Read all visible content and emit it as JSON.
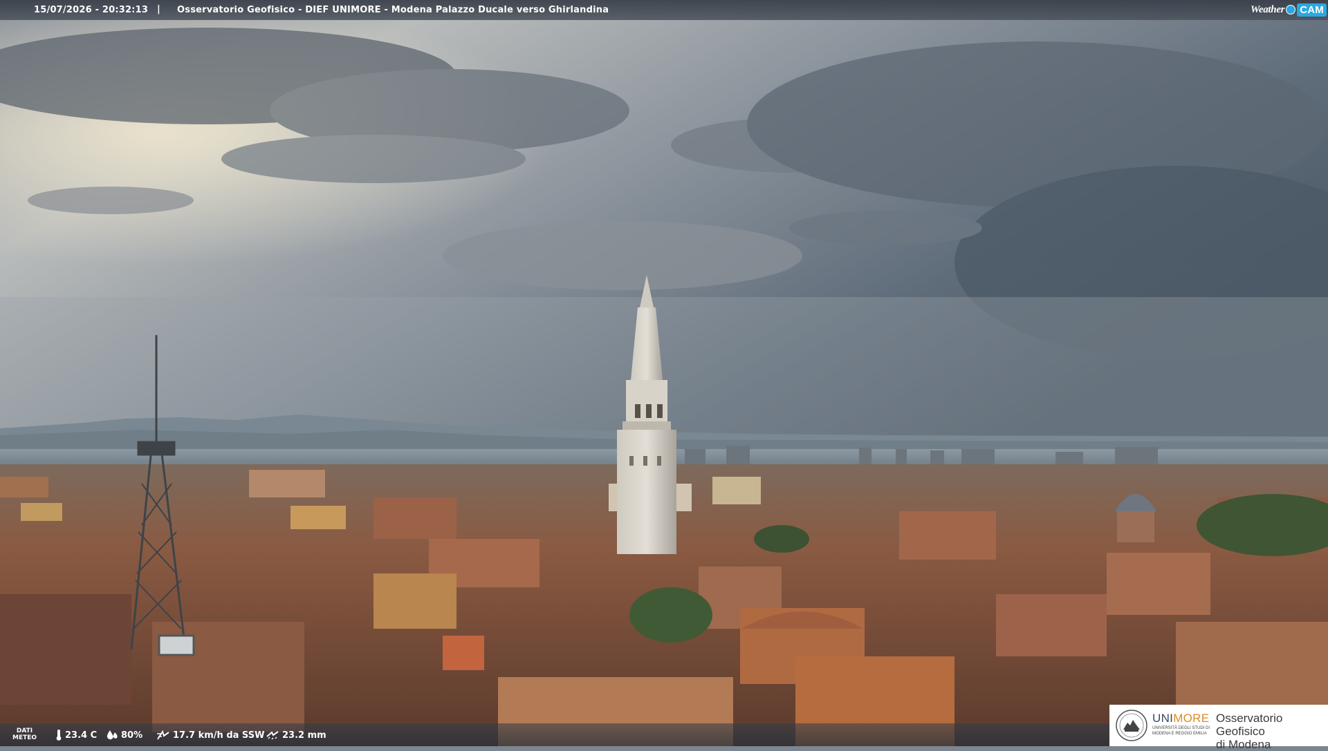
{
  "overlay": {
    "datetime": "15/07/2026 - 20:32:13",
    "separator": "|",
    "caption": "Osservatorio Geofisico - DIEF UNIMORE - Modena Palazzo Ducale verso Ghirlandina"
  },
  "brand": {
    "weather_label": "Weather",
    "cam_label": "CAM"
  },
  "meteo": {
    "label_line1": "DATI",
    "label_line2": "METEO",
    "temperature": "23.4 C",
    "humidity": "80%",
    "wind": "17.7 km/h da SSW",
    "rain": "23.2 mm",
    "icons": [
      "thermometer-icon",
      "humidity-drop-icon",
      "wind-icon",
      "rain-icon"
    ]
  },
  "logo": {
    "uni_prefix": "UNI",
    "uni_suffix": "MORE",
    "uni_sub_line1": "UNIVERSITÀ DEGLI STUDI DI",
    "uni_sub_line2": "MODENA E REGGIO EMILIA",
    "obs_line1": "Osservatorio Geofisico",
    "obs_line2": "di Modena"
  },
  "colors": {
    "sky_top": "#6f7884",
    "sky_light": "#c9cbc8",
    "sky_dark": "#4d5a68",
    "roof": "#8f5a40",
    "brand_blue": "#2aa9e0",
    "unimore_orange": "#e08a1f"
  }
}
